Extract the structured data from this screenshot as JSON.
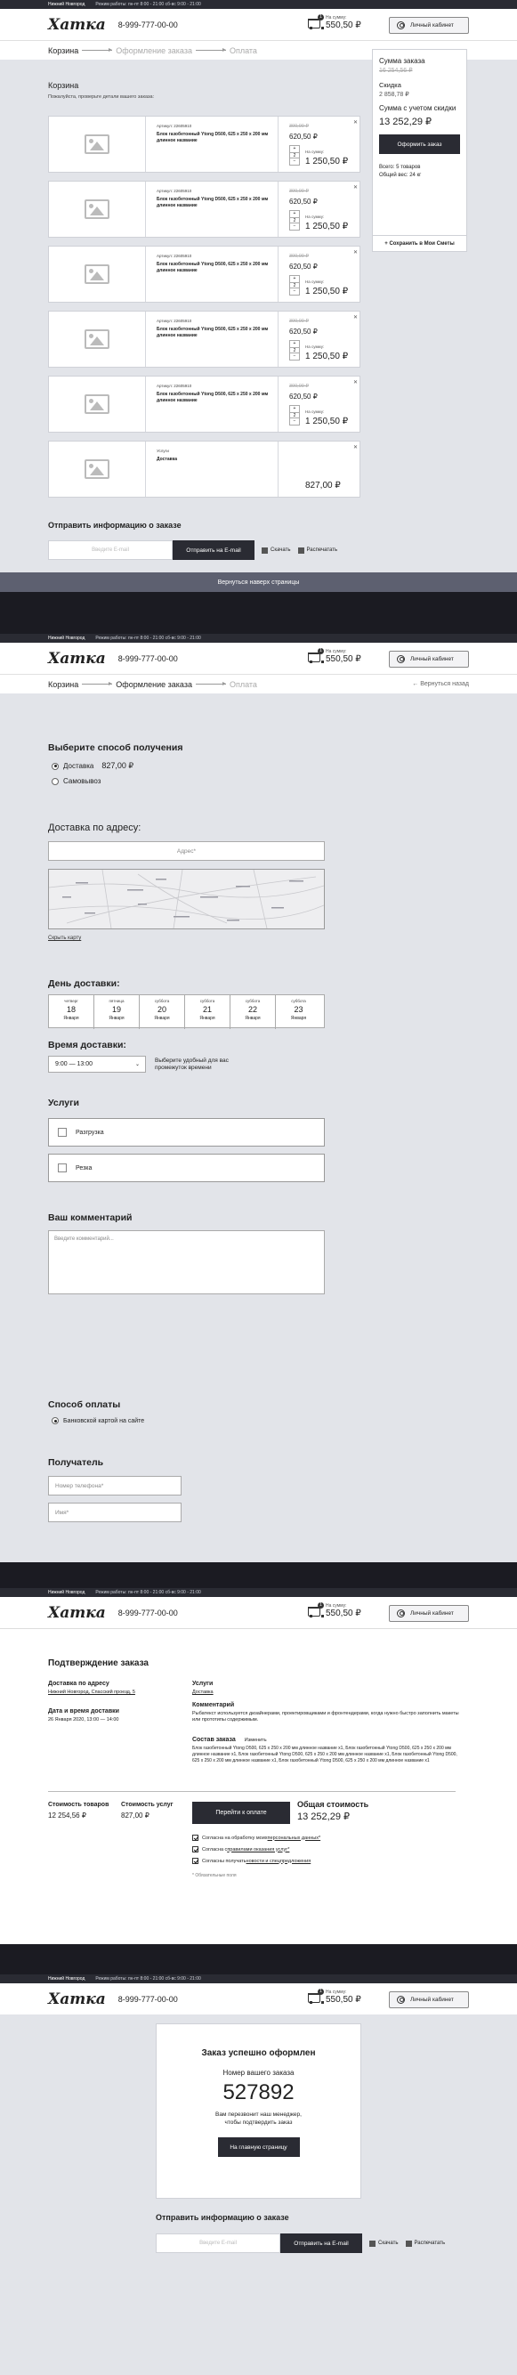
{
  "header": {
    "city": "Нижний Новгород",
    "hours": "Режим работы: пн-пт 8:00 - 21:00 сб-вс 9:00 - 21:00",
    "logo": "Хатка",
    "phone": "8-999-777-00-00",
    "cart_label": "На сумму:",
    "cart_sum": "550,50 ₽",
    "cart_count": "1",
    "cabinet": "Личный кабинет"
  },
  "steps": {
    "cart": "Корзина",
    "checkout": "Оформление заказа",
    "payment": "Оплата",
    "back": "← Вернуться назад"
  },
  "cart": {
    "title": "Корзина",
    "subtitle": "Пожалуйста, проверьте детали вашего заказа:",
    "items": [
      {
        "article": "Артикул: 22605910",
        "name": "Блок газобетонный Ytong D500, 625 х 250 х 200 мм длинное название",
        "old": "300,00 ₽",
        "price": "620,50 ₽",
        "qty": "2",
        "sum_label": "На сумму:",
        "sum": "1 250,50 ₽"
      },
      {
        "article": "Артикул: 22605910",
        "name": "Блок газобетонный Ytong D500, 625 х 250 х 200 мм длинное название",
        "old": "300,00 ₽",
        "price": "620,50 ₽",
        "qty": "2",
        "sum_label": "На сумму:",
        "sum": "1 250,50 ₽"
      },
      {
        "article": "Артикул: 22605910",
        "name": "Блок газобетонный Ytong D500, 625 х 250 х 200 мм длинное название",
        "old": "300,00 ₽",
        "price": "620,50 ₽",
        "qty": "2",
        "sum_label": "На сумму:",
        "sum": "1 250,50 ₽"
      },
      {
        "article": "Артикул: 22605910",
        "name": "Блок газобетонный Ytong D500, 625 х 250 х 200 мм длинное название",
        "old": "300,00 ₽",
        "price": "620,50 ₽",
        "qty": "2",
        "sum_label": "На сумму:",
        "sum": "1 250,50 ₽"
      },
      {
        "article": "Артикул: 22605910",
        "name": "Блок газобетонный Ytong D500, 625 х 250 х 200 мм длинное название",
        "old": "300,00 ₽",
        "price": "620,50 ₽",
        "qty": "2",
        "sum_label": "На сумму:",
        "sum": "1 250,50 ₽"
      }
    ],
    "service": {
      "label": "Услуги",
      "name": "Доставка",
      "price": "827,00 ₽"
    },
    "summary": {
      "order_sum_label": "Сумма заказа",
      "order_sum": "16 254,56 ₽",
      "discount_label": "Скидка",
      "discount": "2 858,78 ₽",
      "with_discount_label": "Сумма с учетом скидки",
      "with_discount": "13 252,29 ₽",
      "order_button": "Оформить заказ",
      "total_items": "Всего: 5 товаров",
      "total_weight": "Общий вес: 24 кг",
      "save": "+ Сохранить в Мои Сметы"
    }
  },
  "email": {
    "title": "Отправить информацию о заказе",
    "placeholder": "Введите E-mail",
    "button": "Отправить на E-mail",
    "opt_download": "Скачать",
    "opt_print": "Распечатать"
  },
  "back_top": "Вернуться наверх страницы",
  "checkout": {
    "method_title": "Выберите способ получения",
    "delivery": "Доставка",
    "delivery_price": "827,00 ₽",
    "pickup": "Самовывоз",
    "address_title": "Доставка по адресу:",
    "address_placeholder": "Адрес*",
    "hide_map": "Скрыть карту",
    "day_title": "День доставки:",
    "days": [
      {
        "dw": "четверг",
        "dn": "18",
        "dm": "Января"
      },
      {
        "dw": "пятница",
        "dn": "19",
        "dm": "Января"
      },
      {
        "dw": "суббота",
        "dn": "20",
        "dm": "Января"
      },
      {
        "dw": "суббота",
        "dn": "21",
        "dm": "Января"
      },
      {
        "dw": "суббота",
        "dn": "22",
        "dm": "Января"
      },
      {
        "dw": "суббота",
        "dn": "23",
        "dm": "Января"
      }
    ],
    "time_title": "Время доставки:",
    "time_value": "9:00 — 13:00",
    "time_hint": "Выберите удобный для вас промежуток времени",
    "services_title": "Услуги",
    "service1": "Разгрузка",
    "service2": "Резка",
    "comment_title": "Ваш комментарий",
    "comment_placeholder": "Введите комментарий...",
    "payment_title": "Способ оплаты",
    "payment_option": "Банковской картой на сайте",
    "recipient_title": "Получатель",
    "phone_placeholder": "Номер телефона*",
    "name_placeholder": "Имя*"
  },
  "confirm": {
    "title": "Подтверждение заказа",
    "addr_label": "Доставка по адресу",
    "addr_value": "Нижний Новгород, Спасский проезд, 5",
    "date_label": "Дата и время доставки",
    "date_value": "26 Января 2020, 13:00 — 14:00",
    "services_label": "Услуги",
    "services_value": "Доставка",
    "comment_label": "Комментарий",
    "comment_value": "Рыбатекст используется дизайнерами, проектировщиками и фронтендерами, когда нужно быстро заполнить макеты или прототипы содержимым.",
    "comp_label": "Состав заказа",
    "comp_edit": "Изменить",
    "comp_value": "Блок газобетонный Ytong D500, 625 х 250 х 200 мм длинное название x1, Блок газобетонный Ytong D500, 625 х 250 х 200 мм длинное название x1, Блок газобетонный Ytong D500, 625 х 250 х 200 мм длинное название x1, Блок газобетонный Ytong D500, 625 х 250 х 200 мм длинное название x1, Блок газобетонный Ytong D500, 625 х 250 х 200 мм длинное название x1",
    "goods_label": "Стоимость товаров",
    "goods_value": "12 254,56 ₽",
    "serv_label": "Стоимость услуг",
    "serv_value": "827,00 ₽",
    "pay_button": "Перейти к оплате",
    "total_label": "Общая стоимость",
    "total_value": "13 252,29 ₽",
    "agree1_pre": "Согласна на обработку моих ",
    "agree1_link": "персональных данных*",
    "agree2_pre": "Согласна с ",
    "agree2_link": "правилами оказания услуг*",
    "agree3_pre": "Согласны получать ",
    "agree3_link": "новости и спецпредложения",
    "required": "* Обязательные поля"
  },
  "success": {
    "title": "Заказ успешно оформлен",
    "num_label": "Номер вашего заказа",
    "num": "527892",
    "text": "Вам перезвонит наш менеджер, чтобы подтвердить заказ",
    "button": "На главную страницу"
  }
}
